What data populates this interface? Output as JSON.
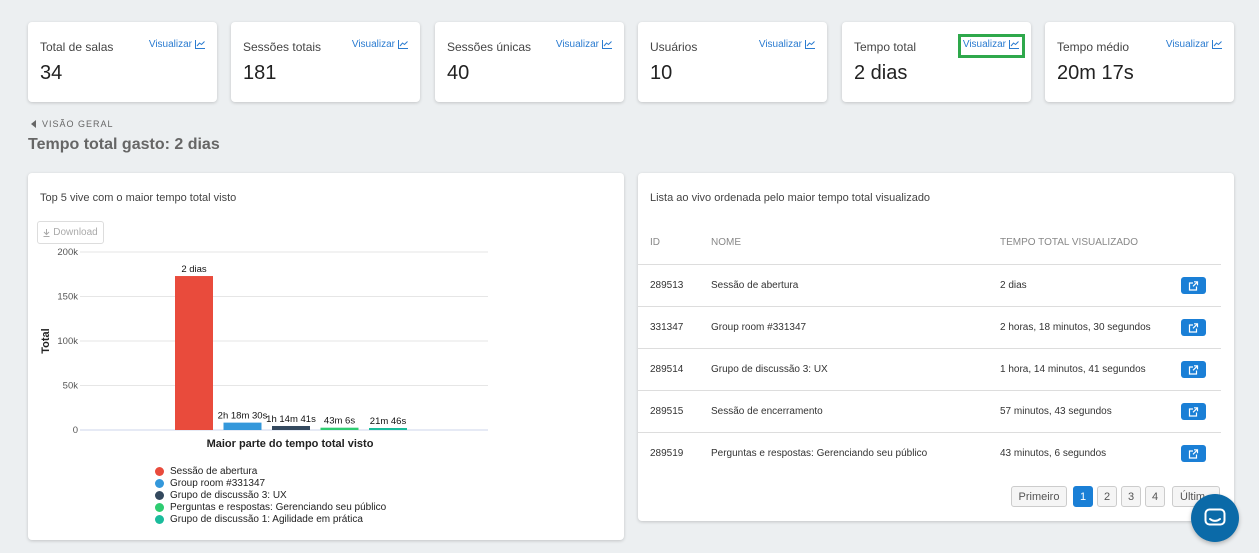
{
  "stats": [
    {
      "label": "Total de salas",
      "value": "34",
      "link": "Visualizar"
    },
    {
      "label": "Sessões totais",
      "value": "181",
      "link": "Visualizar"
    },
    {
      "label": "Sessões únicas",
      "value": "40",
      "link": "Visualizar"
    },
    {
      "label": "Usuários",
      "value": "10",
      "link": "Visualizar"
    },
    {
      "label": "Tempo total",
      "value": "2 dias",
      "link": "Visualizar"
    },
    {
      "label": "Tempo médio",
      "value": "20m 17s",
      "link": "Visualizar"
    }
  ],
  "breadcrumb": "VISÃO GERAL",
  "page_title": "Tempo total gasto: 2 dias",
  "chart_panel": {
    "title": "Top 5 vive com o maior tempo total visto",
    "download_label": "Download"
  },
  "chart_data": {
    "type": "bar",
    "title": "",
    "xlabel": "Maior parte do tempo total visto",
    "ylabel": "Total",
    "ylim": [
      0,
      200000
    ],
    "yticks": [
      "0",
      "50k",
      "100k",
      "150k",
      "200k"
    ],
    "series": [
      {
        "name": "Sessão de abertura",
        "value": 173000,
        "label": "2 dias",
        "color": "#e94b3c"
      },
      {
        "name": "Group room #331347",
        "value": 8300,
        "label": "2h 18m 30s",
        "color": "#3498db"
      },
      {
        "name": "Grupo de discussão 3: UX",
        "value": 4500,
        "label": "1h 14m 41s",
        "color": "#34495e"
      },
      {
        "name": "Perguntas e respostas: Gerenciando seu público",
        "value": 2600,
        "label": "43m 6s",
        "color": "#2ecc71"
      },
      {
        "name": "Grupo de discussão 1: Agilidade em prática",
        "value": 1300,
        "label": "21m 46s",
        "color": "#1abc9c"
      }
    ],
    "grid": true,
    "legend": "bottom"
  },
  "table_panel": {
    "title": "Lista ao vivo ordenada pelo maior tempo total visualizado",
    "headers": [
      "ID",
      "NOME",
      "TEMPO TOTAL VISUALIZADO"
    ],
    "rows": [
      {
        "id": "289513",
        "name": "Sessão de abertura",
        "time": "2 dias"
      },
      {
        "id": "331347",
        "name": "Group room #331347",
        "time": "2 horas, 18 minutos, 30 segundos"
      },
      {
        "id": "289514",
        "name": "Grupo de discussão 3: UX",
        "time": "1 hora, 14 minutos, 41 segundos"
      },
      {
        "id": "289515",
        "name": "Sessão de encerramento",
        "time": "57 minutos, 43 segundos"
      },
      {
        "id": "289519",
        "name": "Perguntas e respostas: Gerenciando seu público",
        "time": "43 minutos, 6 segundos"
      }
    ],
    "pagination": {
      "first": "Primeiro",
      "pages": [
        "1",
        "2",
        "3",
        "4"
      ],
      "current": "1",
      "last": "Últim"
    }
  }
}
